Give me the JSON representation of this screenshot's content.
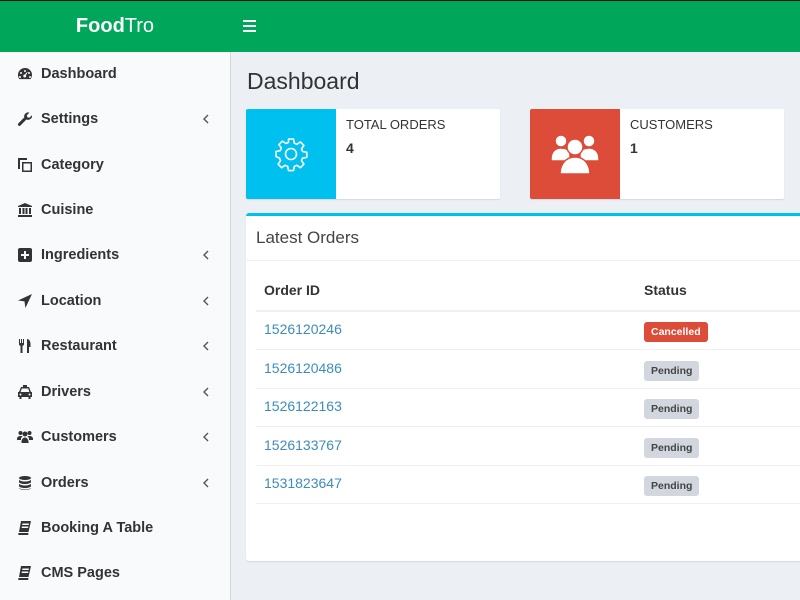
{
  "app": {
    "brand_bold": "Food",
    "brand_light": "Tro"
  },
  "header": {
    "menu_toggle_icon": "hamburger-icon"
  },
  "sidebar": {
    "items": [
      {
        "label": "Dashboard",
        "icon": "dashboard-icon",
        "has_submenu": false
      },
      {
        "label": "Settings",
        "icon": "wrench-icon",
        "has_submenu": true
      },
      {
        "label": "Category",
        "icon": "copy-icon",
        "has_submenu": false
      },
      {
        "label": "Cuisine",
        "icon": "bank-icon",
        "has_submenu": false
      },
      {
        "label": "Ingredients",
        "icon": "plus-square-icon",
        "has_submenu": true
      },
      {
        "label": "Location",
        "icon": "location-arrow-icon",
        "has_submenu": true
      },
      {
        "label": "Restaurant",
        "icon": "cutlery-icon",
        "has_submenu": true
      },
      {
        "label": "Drivers",
        "icon": "taxi-icon",
        "has_submenu": true
      },
      {
        "label": "Customers",
        "icon": "users-icon",
        "has_submenu": true
      },
      {
        "label": "Orders",
        "icon": "database-icon",
        "has_submenu": true
      },
      {
        "label": "Booking A Table",
        "icon": "book-icon",
        "has_submenu": false
      },
      {
        "label": "CMS Pages",
        "icon": "book-icon",
        "has_submenu": false
      }
    ]
  },
  "main": {
    "title": "Dashboard",
    "info_boxes": [
      {
        "label": "TOTAL ORDERS",
        "value": "4",
        "icon": "gear-icon",
        "color": "#00c0ef"
      },
      {
        "label": "CUSTOMERS",
        "value": "1",
        "icon": "users-icon",
        "color": "#dd4b39"
      }
    ],
    "latest_orders": {
      "title": "Latest Orders",
      "columns": [
        "Order ID",
        "Status"
      ],
      "rows": [
        {
          "order_id": "1526120246",
          "status": "Cancelled"
        },
        {
          "order_id": "1526120486",
          "status": "Pending"
        },
        {
          "order_id": "1526122163",
          "status": "Pending"
        },
        {
          "order_id": "1526133767",
          "status": "Pending"
        },
        {
          "order_id": "1531823647",
          "status": "Pending"
        }
      ]
    }
  },
  "colors": {
    "header_green": "#00a65a",
    "info_aqua": "#00c0ef",
    "danger_red": "#dd4b39",
    "link_blue": "#3c8dbc",
    "pending_gray": "#d2d6de"
  }
}
